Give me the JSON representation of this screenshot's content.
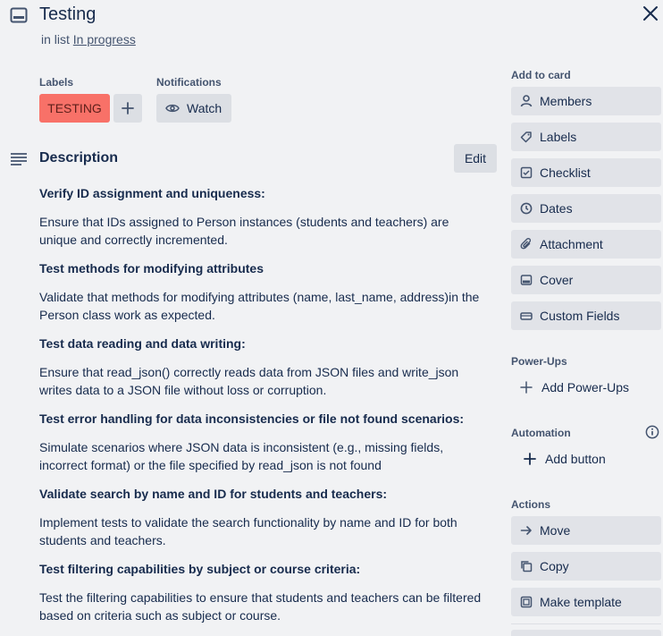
{
  "header": {
    "title": "Testing",
    "in_list_prefix": "in list ",
    "list_name": "In progress"
  },
  "labels": {
    "heading": "Labels",
    "chip": "TESTING",
    "chip_color": "#f87168"
  },
  "notifications": {
    "heading": "Notifications",
    "watch_label": "Watch"
  },
  "description": {
    "heading": "Description",
    "edit_label": "Edit",
    "blocks": [
      {
        "title": "Verify ID assignment and uniqueness:",
        "text": "Ensure that IDs assigned to Person instances (students and teachers) are unique and correctly incremented."
      },
      {
        "title": "Test methods for modifying attributes",
        "text": "Validate that methods for modifying attributes (name, last_name, address)in the Person class work as expected."
      },
      {
        "title": "Test data reading and data writing:",
        "text": "Ensure that read_json() correctly reads data from JSON files and write_json writes data to a JSON file without loss or corruption."
      },
      {
        "title": "Test error handling for data inconsistencies or file not found scenarios:",
        "text": "Simulate scenarios where JSON data is inconsistent (e.g., missing fields, incorrect format) or the file specified by read_json is not found"
      },
      {
        "title": "Validate search by name and ID for students and teachers:",
        "text": "Implement tests to validate the search functionality by name and ID for both students and teachers."
      },
      {
        "title": "Test filtering capabilities by subject or course criteria:",
        "text": "Test the filtering capabilities to ensure that students and teachers can be filtered based on criteria such as subject or course."
      }
    ]
  },
  "sidebar": {
    "add_to_card": "Add to card",
    "add_items": [
      "Members",
      "Labels",
      "Checklist",
      "Dates",
      "Attachment",
      "Cover",
      "Custom Fields"
    ],
    "powerups_heading": "Power-Ups",
    "add_powerups": "Add Power-Ups",
    "automation_heading": "Automation",
    "add_button": "Add button",
    "actions_heading": "Actions",
    "action_items": [
      "Move",
      "Copy",
      "Make template"
    ]
  }
}
